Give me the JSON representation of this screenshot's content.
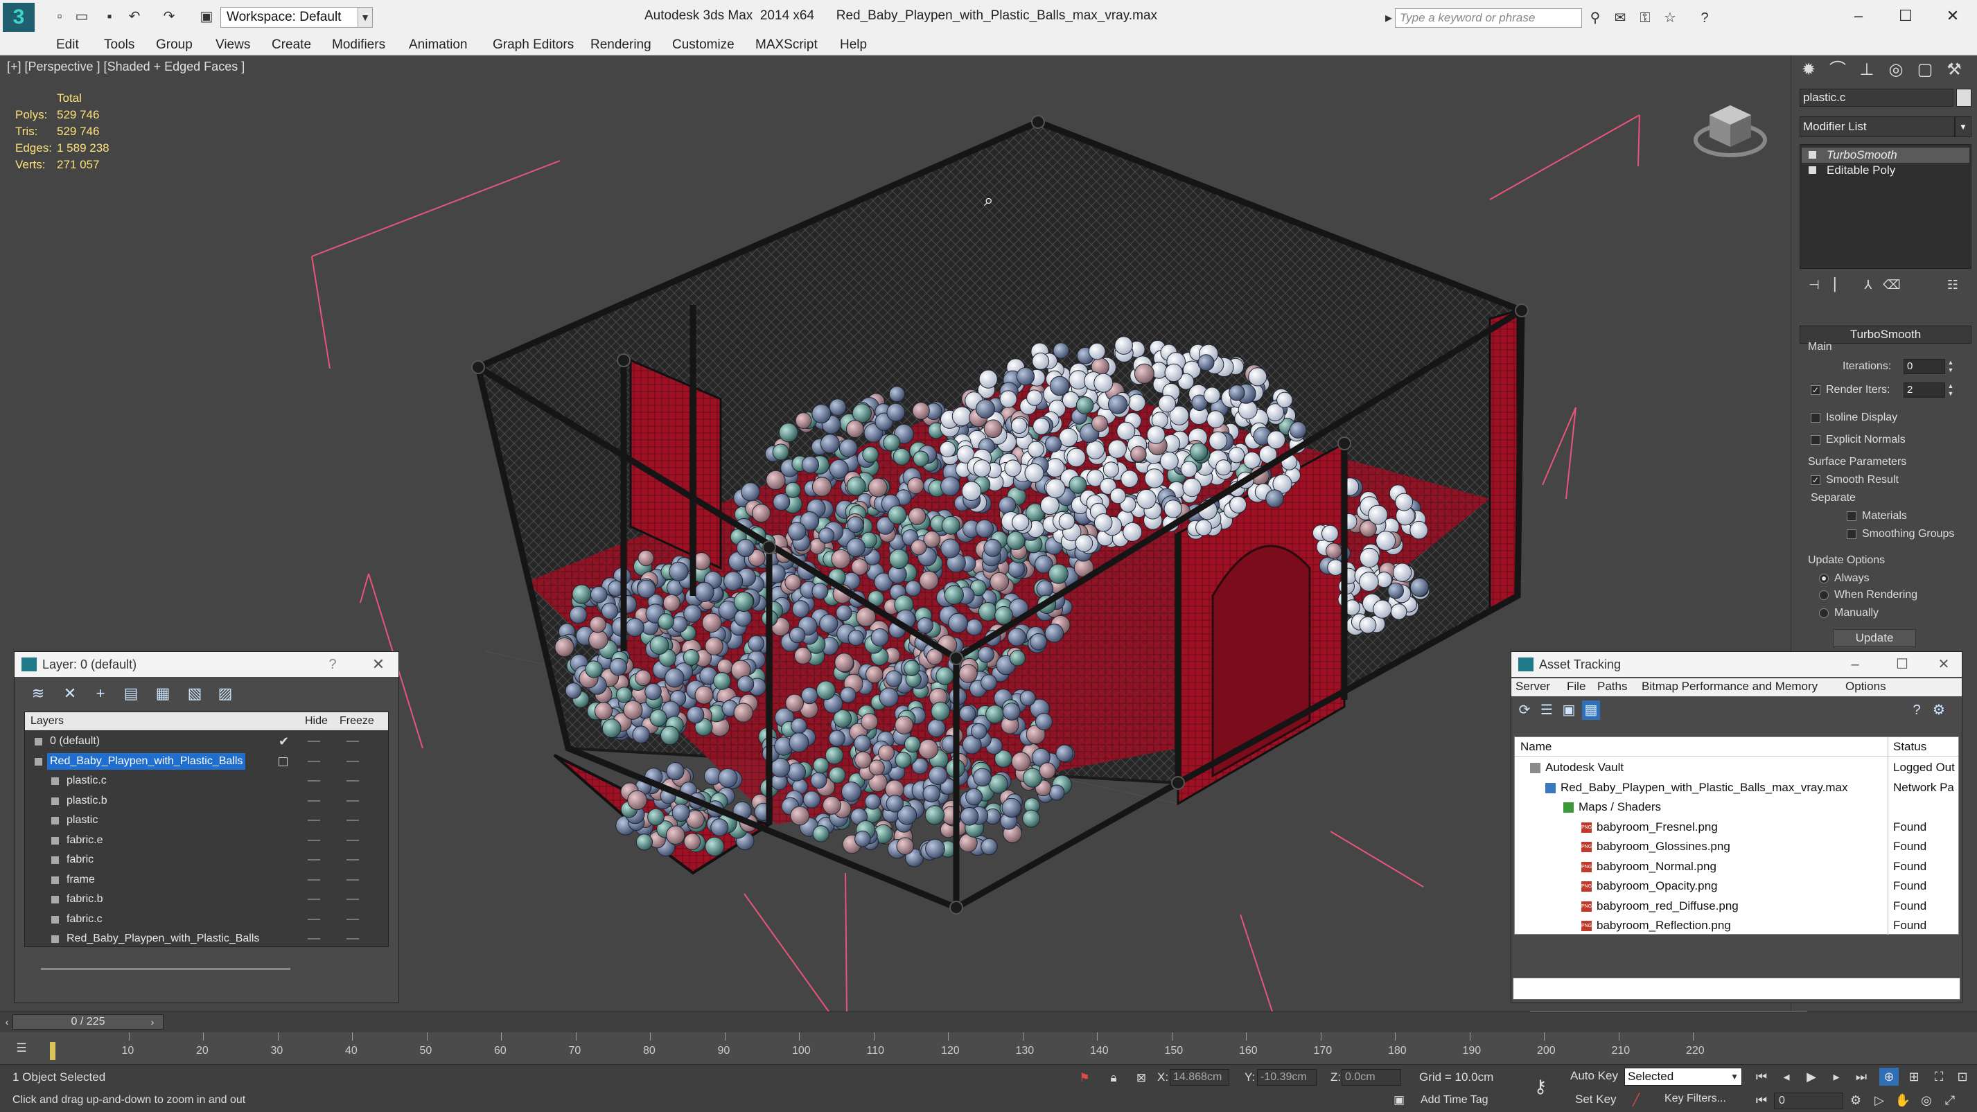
{
  "app": {
    "title": "Autodesk 3ds Max  2014 x64",
    "file": "Red_Baby_Playpen_with_Plastic_Balls_max_vray.max",
    "workspace": "Workspace: Default",
    "search_placeholder": "Type a keyword or phrase"
  },
  "menu": [
    "Edit",
    "Tools",
    "Group",
    "Views",
    "Create",
    "Modifiers",
    "Animation",
    "Graph Editors",
    "Rendering",
    "Customize",
    "MAXScript",
    "Help"
  ],
  "viewport": {
    "label": "[+] [Perspective ] [Shaded + Edged Faces ]",
    "stats_header": "Total",
    "stats": [
      {
        "k": "Polys:",
        "v": "529 746"
      },
      {
        "k": "Tris:",
        "v": "529 746"
      },
      {
        "k": "Edges:",
        "v": "1 589 238"
      },
      {
        "k": "Verts:",
        "v": "271 057"
      }
    ]
  },
  "command_panel": {
    "object_name": "plastic.c",
    "modifier_list": "Modifier List",
    "stack": [
      "TurboSmooth",
      "Editable Poly"
    ],
    "turbosmooth": {
      "title": "TurboSmooth",
      "main": "Main",
      "iterations_label": "Iterations:",
      "iterations": "0",
      "render_iters_label": "Render Iters:",
      "render_iters": "2",
      "isoline": "Isoline Display",
      "explicit_normals": "Explicit Normals",
      "surface_params": "Surface Parameters",
      "smooth_result": "Smooth Result",
      "separate": "Separate",
      "materials": "Materials",
      "smoothing_groups": "Smoothing Groups",
      "update_options": "Update Options",
      "always": "Always",
      "when_rendering": "When Rendering",
      "manually": "Manually",
      "update": "Update"
    }
  },
  "layers": {
    "title": "Layer: 0 (default)",
    "col_layers": "Layers",
    "col_hide": "Hide",
    "col_freeze": "Freeze",
    "rows": [
      {
        "name": "0 (default)",
        "level": 0,
        "checked": true,
        "selected": false
      },
      {
        "name": "Red_Baby_Playpen_with_Plastic_Balls",
        "level": 0,
        "checked": false,
        "selected": true
      },
      {
        "name": "plastic.c",
        "level": 1
      },
      {
        "name": "plastic.b",
        "level": 1
      },
      {
        "name": "plastic",
        "level": 1
      },
      {
        "name": "fabric.e",
        "level": 1
      },
      {
        "name": "fabric",
        "level": 1
      },
      {
        "name": "frame",
        "level": 1
      },
      {
        "name": "fabric.b",
        "level": 1
      },
      {
        "name": "fabric.c",
        "level": 1
      },
      {
        "name": "Red_Baby_Playpen_with_Plastic_Balls",
        "level": 1
      }
    ]
  },
  "asset_tracking": {
    "title": "Asset Tracking",
    "menu": [
      "Server",
      "File",
      "Paths",
      "Bitmap Performance and Memory",
      "Options"
    ],
    "col_name": "Name",
    "col_status": "Status",
    "rows": [
      {
        "name": "Autodesk Vault",
        "status": "Logged Out",
        "level": 1
      },
      {
        "name": "Red_Baby_Playpen_with_Plastic_Balls_max_vray.max",
        "status": "Network Pa",
        "level": 2
      },
      {
        "name": "Maps / Shaders",
        "status": "",
        "level": 3
      },
      {
        "name": "babyroom_Fresnel.png",
        "status": "Found",
        "level": 4
      },
      {
        "name": "babyroom_Glossines.png",
        "status": "Found",
        "level": 4
      },
      {
        "name": "babyroom_Normal.png",
        "status": "Found",
        "level": 4
      },
      {
        "name": "babyroom_Opacity.png",
        "status": "Found",
        "level": 4
      },
      {
        "name": "babyroom_red_Diffuse.png",
        "status": "Found",
        "level": 4
      },
      {
        "name": "babyroom_Reflection.png",
        "status": "Found",
        "level": 4
      }
    ]
  },
  "timeline": {
    "frame_display": "0 / 225",
    "ticks": [
      "10",
      "20",
      "30",
      "40",
      "50",
      "60",
      "70",
      "80",
      "90",
      "100",
      "110",
      "120",
      "130",
      "140",
      "150",
      "160",
      "170",
      "180",
      "190",
      "200",
      "210",
      "220"
    ]
  },
  "status": {
    "selected": "1 Object Selected",
    "prompt": "Click and drag up-and-down to zoom in and out",
    "x_label": "X:",
    "x": "14.868cm",
    "y_label": "Y:",
    "y": "-10.39cm",
    "z_label": "Z:",
    "z": "0.0cm",
    "grid": "Grid = 10.0cm",
    "add_time_tag": "Add Time Tag",
    "auto_key": "Auto Key",
    "set_key": "Set Key",
    "selected_option": "Selected",
    "key_filters": "Key Filters...",
    "frame": "0"
  },
  "colors": {
    "accent": "#1e6fd0",
    "stats": "#ffe27a",
    "playpen": "#b3122a"
  }
}
